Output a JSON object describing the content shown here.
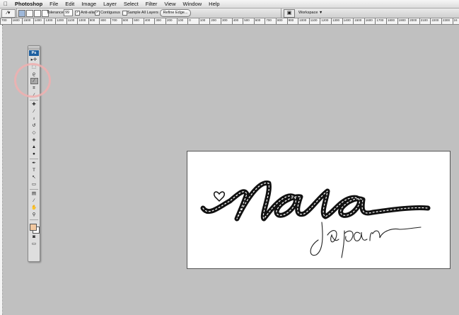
{
  "menubar": {
    "apple_icon": "apple-logo",
    "app_name": "Photoshop",
    "items": [
      "File",
      "Edit",
      "Image",
      "Layer",
      "Select",
      "Filter",
      "View",
      "Window",
      "Help"
    ]
  },
  "options_bar": {
    "tool_icon": "magic-wand-icon",
    "tolerance_label": "Tolerance:",
    "tolerance_value": "99",
    "anti_alias_label": "Anti-alias",
    "anti_alias_checked": true,
    "contiguous_label": "Contiguous",
    "contiguous_checked": true,
    "sample_all_layers_label": "Sample All Layers",
    "sample_all_layers_checked": false,
    "refine_edge_label": "Refine Edge...",
    "workspace_label": "Workspace ▼"
  },
  "ruler": {
    "ticks": [
      "700",
      "1600",
      "1500",
      "1400",
      "1300",
      "1200",
      "1100",
      "1000",
      "900",
      "800",
      "700",
      "600",
      "500",
      "400",
      "300",
      "200",
      "100",
      "0",
      "100",
      "200",
      "300",
      "400",
      "500",
      "600",
      "700",
      "800",
      "900",
      "1000",
      "1100",
      "1200",
      "1300",
      "1400",
      "1500",
      "1600",
      "1700",
      "1800",
      "1900",
      "2000",
      "2100",
      "2200",
      "2300",
      "24"
    ]
  },
  "toolbox": {
    "logo": "Ps",
    "tools": [
      {
        "name": "move-tool",
        "glyph": "▸✛"
      },
      {
        "name": "marquee-tool",
        "glyph": "⬚"
      },
      {
        "name": "lasso-tool",
        "glyph": "ϱ"
      },
      {
        "name": "magic-wand-tool",
        "glyph": "⁄"
      },
      {
        "name": "crop-tool",
        "glyph": "⌗"
      },
      {
        "name": "slice-tool",
        "glyph": "⁄"
      },
      {
        "name": "healing-brush-tool",
        "glyph": "✚"
      },
      {
        "name": "brush-tool",
        "glyph": "⁄"
      },
      {
        "name": "clone-stamp-tool",
        "glyph": "♁"
      },
      {
        "name": "history-brush-tool",
        "glyph": "↺"
      },
      {
        "name": "eraser-tool",
        "glyph": "◇"
      },
      {
        "name": "paint-bucket-tool",
        "glyph": "◈"
      },
      {
        "name": "blur-tool",
        "glyph": "▲"
      },
      {
        "name": "dodge-tool",
        "glyph": "●"
      },
      {
        "name": "pen-tool",
        "glyph": "✒"
      },
      {
        "name": "type-tool",
        "glyph": "T"
      },
      {
        "name": "path-selection-tool",
        "glyph": "↖"
      },
      {
        "name": "shape-tool",
        "glyph": "▭"
      },
      {
        "name": "notes-tool",
        "glyph": "▤"
      },
      {
        "name": "eyedropper-tool",
        "glyph": "⁄"
      },
      {
        "name": "hand-tool",
        "glyph": "✋"
      },
      {
        "name": "zoom-tool",
        "glyph": "⚲"
      }
    ],
    "active_tool_index": 3,
    "foreground_color": "#f1c8a0",
    "background_color": "#ffffff"
  },
  "document": {
    "description_colors": {
      "ink": "#111111",
      "paper": "#ffffff"
    }
  }
}
